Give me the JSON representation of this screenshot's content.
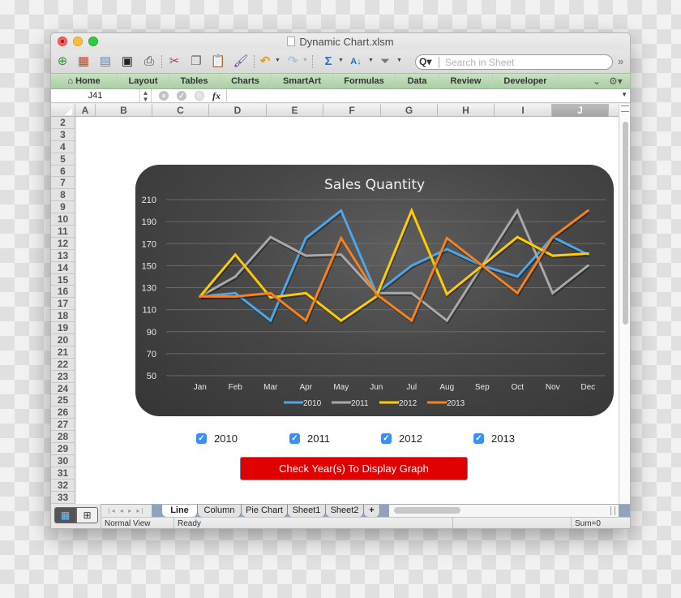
{
  "window": {
    "title": "Dynamic Chart.xlsm"
  },
  "toolbar": {
    "icons": [
      "new-workbook-icon",
      "gallery-icon",
      "open-icon",
      "save-icon",
      "print-icon",
      "cut-icon",
      "copy-icon",
      "paste-icon",
      "format-painter-icon",
      "undo-icon",
      "redo-icon",
      "autosum-icon",
      "sort-icon",
      "filter-icon"
    ],
    "search_placeholder": "Search in Sheet",
    "more_label": "»"
  },
  "ribbon": {
    "tabs": [
      {
        "label": "Home",
        "icon": "home-icon"
      },
      {
        "label": "Layout"
      },
      {
        "label": "Tables"
      },
      {
        "label": "Charts"
      },
      {
        "label": "SmartArt"
      },
      {
        "label": "Formulas"
      },
      {
        "label": "Data"
      },
      {
        "label": "Review"
      },
      {
        "label": "Developer"
      }
    ]
  },
  "formula_bar": {
    "name_box": "J41",
    "fx_label": "fx",
    "value": ""
  },
  "grid": {
    "columns": [
      "A",
      "B",
      "C",
      "D",
      "E",
      "F",
      "G",
      "H",
      "I",
      "J"
    ],
    "selected_column": "J",
    "rows": [
      "2",
      "3",
      "4",
      "5",
      "6",
      "7",
      "8",
      "9",
      "10",
      "11",
      "12",
      "13",
      "14",
      "15",
      "16",
      "17",
      "18",
      "19",
      "20",
      "21",
      "22",
      "23",
      "24",
      "25",
      "26",
      "27",
      "28",
      "29",
      "30",
      "31",
      "32",
      "33"
    ]
  },
  "chart_data": {
    "type": "line",
    "title": "Sales Quantity",
    "xlabel": "",
    "ylabel": "",
    "categories": [
      "Jan",
      "Feb",
      "Mar",
      "Apr",
      "May",
      "Jun",
      "Jul",
      "Aug",
      "Sep",
      "Oct",
      "Nov",
      "Dec"
    ],
    "yticks": [
      50,
      70,
      90,
      110,
      130,
      150,
      170,
      190,
      210
    ],
    "ylim": [
      50,
      210
    ],
    "grid": true,
    "legend_position": "bottom",
    "series": [
      {
        "name": "2010",
        "color": "#4ea6e6",
        "values": [
          122,
          125,
          100,
          175,
          200,
          125,
          150,
          165,
          150,
          140,
          176,
          160
        ]
      },
      {
        "name": "2011",
        "color": "#a9a9a9",
        "values": [
          122,
          140,
          176,
          159,
          160,
          125,
          125,
          100,
          150,
          200,
          125,
          150
        ]
      },
      {
        "name": "2012",
        "color": "#ffcc00",
        "values": [
          122,
          160,
          121,
          125,
          100,
          122,
          200,
          124,
          150,
          176,
          159,
          161
        ]
      },
      {
        "name": "2013",
        "color": "#f58220",
        "values": [
          122,
          122,
          125,
          100,
          175,
          124,
          100,
          175,
          150,
          125,
          176,
          200
        ]
      }
    ]
  },
  "controls": {
    "checkboxes": [
      {
        "label": "2010",
        "checked": true
      },
      {
        "label": "2011",
        "checked": true
      },
      {
        "label": "2012",
        "checked": true
      },
      {
        "label": "2013",
        "checked": true
      }
    ],
    "action_button": "Check Year(s) To Display Graph",
    "action_button_color": "#e00000"
  },
  "sheet_tabs": {
    "nav": "|◂ ◂ ▸ ▸|",
    "tabs": [
      "Line",
      "Column",
      "Pie Chart",
      "Sheet1",
      "Sheet2"
    ],
    "active": "Line",
    "add_label": "+"
  },
  "status_bar": {
    "view": "Normal View",
    "state": "Ready",
    "sum": "Sum=0"
  }
}
